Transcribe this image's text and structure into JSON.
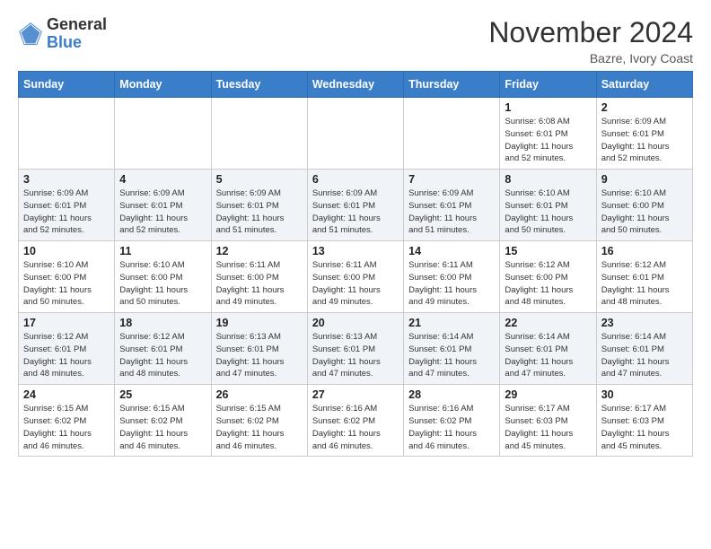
{
  "header": {
    "logo_general": "General",
    "logo_blue": "Blue",
    "month_title": "November 2024",
    "location": "Bazre, Ivory Coast"
  },
  "days_of_week": [
    "Sunday",
    "Monday",
    "Tuesday",
    "Wednesday",
    "Thursday",
    "Friday",
    "Saturday"
  ],
  "weeks": [
    [
      {
        "day": "",
        "info": ""
      },
      {
        "day": "",
        "info": ""
      },
      {
        "day": "",
        "info": ""
      },
      {
        "day": "",
        "info": ""
      },
      {
        "day": "",
        "info": ""
      },
      {
        "day": "1",
        "info": "Sunrise: 6:08 AM\nSunset: 6:01 PM\nDaylight: 11 hours\nand 52 minutes."
      },
      {
        "day": "2",
        "info": "Sunrise: 6:09 AM\nSunset: 6:01 PM\nDaylight: 11 hours\nand 52 minutes."
      }
    ],
    [
      {
        "day": "3",
        "info": "Sunrise: 6:09 AM\nSunset: 6:01 PM\nDaylight: 11 hours\nand 52 minutes."
      },
      {
        "day": "4",
        "info": "Sunrise: 6:09 AM\nSunset: 6:01 PM\nDaylight: 11 hours\nand 52 minutes."
      },
      {
        "day": "5",
        "info": "Sunrise: 6:09 AM\nSunset: 6:01 PM\nDaylight: 11 hours\nand 51 minutes."
      },
      {
        "day": "6",
        "info": "Sunrise: 6:09 AM\nSunset: 6:01 PM\nDaylight: 11 hours\nand 51 minutes."
      },
      {
        "day": "7",
        "info": "Sunrise: 6:09 AM\nSunset: 6:01 PM\nDaylight: 11 hours\nand 51 minutes."
      },
      {
        "day": "8",
        "info": "Sunrise: 6:10 AM\nSunset: 6:01 PM\nDaylight: 11 hours\nand 50 minutes."
      },
      {
        "day": "9",
        "info": "Sunrise: 6:10 AM\nSunset: 6:00 PM\nDaylight: 11 hours\nand 50 minutes."
      }
    ],
    [
      {
        "day": "10",
        "info": "Sunrise: 6:10 AM\nSunset: 6:00 PM\nDaylight: 11 hours\nand 50 minutes."
      },
      {
        "day": "11",
        "info": "Sunrise: 6:10 AM\nSunset: 6:00 PM\nDaylight: 11 hours\nand 50 minutes."
      },
      {
        "day": "12",
        "info": "Sunrise: 6:11 AM\nSunset: 6:00 PM\nDaylight: 11 hours\nand 49 minutes."
      },
      {
        "day": "13",
        "info": "Sunrise: 6:11 AM\nSunset: 6:00 PM\nDaylight: 11 hours\nand 49 minutes."
      },
      {
        "day": "14",
        "info": "Sunrise: 6:11 AM\nSunset: 6:00 PM\nDaylight: 11 hours\nand 49 minutes."
      },
      {
        "day": "15",
        "info": "Sunrise: 6:12 AM\nSunset: 6:00 PM\nDaylight: 11 hours\nand 48 minutes."
      },
      {
        "day": "16",
        "info": "Sunrise: 6:12 AM\nSunset: 6:01 PM\nDaylight: 11 hours\nand 48 minutes."
      }
    ],
    [
      {
        "day": "17",
        "info": "Sunrise: 6:12 AM\nSunset: 6:01 PM\nDaylight: 11 hours\nand 48 minutes."
      },
      {
        "day": "18",
        "info": "Sunrise: 6:12 AM\nSunset: 6:01 PM\nDaylight: 11 hours\nand 48 minutes."
      },
      {
        "day": "19",
        "info": "Sunrise: 6:13 AM\nSunset: 6:01 PM\nDaylight: 11 hours\nand 47 minutes."
      },
      {
        "day": "20",
        "info": "Sunrise: 6:13 AM\nSunset: 6:01 PM\nDaylight: 11 hours\nand 47 minutes."
      },
      {
        "day": "21",
        "info": "Sunrise: 6:14 AM\nSunset: 6:01 PM\nDaylight: 11 hours\nand 47 minutes."
      },
      {
        "day": "22",
        "info": "Sunrise: 6:14 AM\nSunset: 6:01 PM\nDaylight: 11 hours\nand 47 minutes."
      },
      {
        "day": "23",
        "info": "Sunrise: 6:14 AM\nSunset: 6:01 PM\nDaylight: 11 hours\nand 47 minutes."
      }
    ],
    [
      {
        "day": "24",
        "info": "Sunrise: 6:15 AM\nSunset: 6:02 PM\nDaylight: 11 hours\nand 46 minutes."
      },
      {
        "day": "25",
        "info": "Sunrise: 6:15 AM\nSunset: 6:02 PM\nDaylight: 11 hours\nand 46 minutes."
      },
      {
        "day": "26",
        "info": "Sunrise: 6:15 AM\nSunset: 6:02 PM\nDaylight: 11 hours\nand 46 minutes."
      },
      {
        "day": "27",
        "info": "Sunrise: 6:16 AM\nSunset: 6:02 PM\nDaylight: 11 hours\nand 46 minutes."
      },
      {
        "day": "28",
        "info": "Sunrise: 6:16 AM\nSunset: 6:02 PM\nDaylight: 11 hours\nand 46 minutes."
      },
      {
        "day": "29",
        "info": "Sunrise: 6:17 AM\nSunset: 6:03 PM\nDaylight: 11 hours\nand 45 minutes."
      },
      {
        "day": "30",
        "info": "Sunrise: 6:17 AM\nSunset: 6:03 PM\nDaylight: 11 hours\nand 45 minutes."
      }
    ]
  ]
}
